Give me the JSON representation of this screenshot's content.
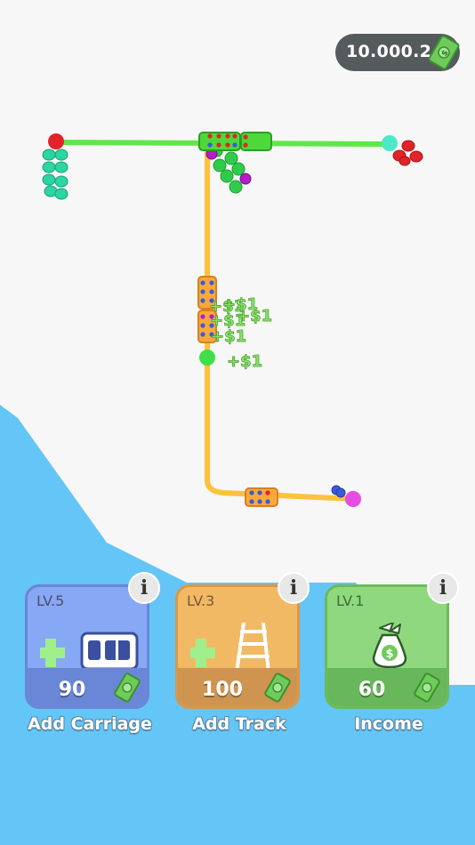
{
  "hud": {
    "money": "10.000.2",
    "money_icon": "cash-bill-icon"
  },
  "board": {
    "background_color": "#f7f7f7",
    "track_color_green": "#5fe74a",
    "track_color_orange": "#fcc23c"
  },
  "floating_rewards": [
    "+$1",
    "+$1",
    "+$1",
    "+$1",
    "+$1",
    "+$1"
  ],
  "upgrades": [
    {
      "level": "LV.5",
      "cost": "90",
      "title": "Add Carriage",
      "icon": "carriage-icon",
      "color": "#86a8f5"
    },
    {
      "level": "LV.3",
      "cost": "100",
      "title": "Add Track",
      "icon": "ladder-icon",
      "color": "#f2b964"
    },
    {
      "level": "LV.1",
      "cost": "60",
      "title": "Income",
      "icon": "money-bag-icon",
      "color": "#8fd87e"
    }
  ],
  "info_label": "i",
  "colors": {
    "passenger_teal": "#2bd6a0",
    "passenger_red": "#e2232a",
    "passenger_purple": "#b51cc9",
    "passenger_green": "#2fcc4a"
  }
}
